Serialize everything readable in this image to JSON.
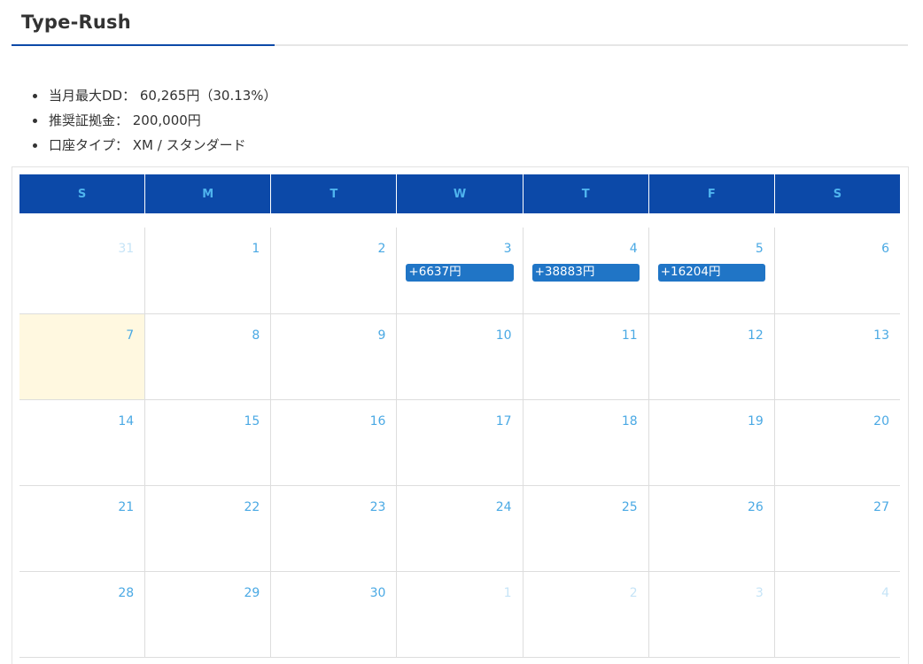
{
  "heading": {
    "title": "Type-Rush"
  },
  "info": [
    "当月最大DD： 60,265円（30.13%）",
    "推奨証拠金： 200,000円",
    "口座タイプ： XM / スタンダード"
  ],
  "calendar": {
    "weekdays": [
      "S",
      "M",
      "T",
      "W",
      "T",
      "F",
      "S"
    ],
    "weeks": [
      [
        {
          "day": "31",
          "other_month": true
        },
        {
          "day": "1"
        },
        {
          "day": "2"
        },
        {
          "day": "3",
          "event": "+6637円"
        },
        {
          "day": "4",
          "event": "+38883円"
        },
        {
          "day": "5",
          "event": "+16204円"
        },
        {
          "day": "6"
        }
      ],
      [
        {
          "day": "7",
          "today": true
        },
        {
          "day": "8"
        },
        {
          "day": "9"
        },
        {
          "day": "10"
        },
        {
          "day": "11"
        },
        {
          "day": "12"
        },
        {
          "day": "13"
        }
      ],
      [
        {
          "day": "14"
        },
        {
          "day": "15"
        },
        {
          "day": "16"
        },
        {
          "day": "17"
        },
        {
          "day": "18"
        },
        {
          "day": "19"
        },
        {
          "day": "20"
        }
      ],
      [
        {
          "day": "21"
        },
        {
          "day": "22"
        },
        {
          "day": "23"
        },
        {
          "day": "24"
        },
        {
          "day": "25"
        },
        {
          "day": "26"
        },
        {
          "day": "27"
        }
      ],
      [
        {
          "day": "28"
        },
        {
          "day": "29"
        },
        {
          "day": "30"
        },
        {
          "day": "1",
          "other_month": true
        },
        {
          "day": "2",
          "other_month": true
        },
        {
          "day": "3",
          "other_month": true
        },
        {
          "day": "4",
          "other_month": true
        }
      ]
    ]
  },
  "colors": {
    "header_bg": "#0c49a8",
    "header_text": "#4fb4ee",
    "day_number": "#4aa9e4",
    "other_month_day": "#c6e4f7",
    "event_bg": "#2075c6",
    "today_bg": "#fff8e0"
  }
}
